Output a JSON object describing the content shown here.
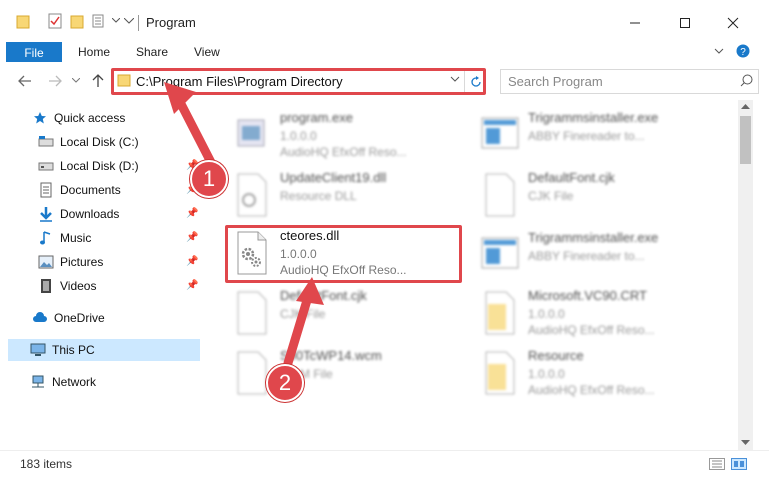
{
  "window": {
    "title": "Program"
  },
  "ribbon": {
    "file": "File",
    "home": "Home",
    "share": "Share",
    "view": "View"
  },
  "address": {
    "path": "C:\\Program Files\\Program Directory"
  },
  "search": {
    "placeholder": "Search Program"
  },
  "sidebar": {
    "quick_access": "Quick access",
    "items": [
      {
        "label": "Local Disk (C:)"
      },
      {
        "label": "Local Disk (D:)"
      },
      {
        "label": "Documents"
      },
      {
        "label": "Downloads"
      },
      {
        "label": "Music"
      },
      {
        "label": "Pictures"
      },
      {
        "label": "Videos"
      }
    ],
    "onedrive": "OneDrive",
    "this_pc": "This PC",
    "network": "Network"
  },
  "files": {
    "f1": {
      "name": "program.exe",
      "l2": "1.0.0.0",
      "l3": "AudioHQ EfxOff Reso..."
    },
    "f2": {
      "name": "Trigrammsinstaller.exe",
      "l2": "ABBY Finereader to..."
    },
    "f3": {
      "name": "UpdateClient19.dll",
      "l2": "Resource DLL"
    },
    "f4": {
      "name": "DefaultFont.cjk",
      "l2": "CJK File"
    },
    "f5": {
      "name": "cteores.dll",
      "l2": "1.0.0.0",
      "l3": "AudioHQ EfxOff Reso..."
    },
    "f6": {
      "name": "Trigrammsinstaller.exe",
      "l2": "ABBY Finereader to..."
    },
    "f7": {
      "name": "DefaultFont.cjk",
      "l2": "CJK File"
    },
    "f8": {
      "name": "Microsoft.VC90.CRT",
      "l2": "1.0.0.0",
      "l3": "AudioHQ EfxOff Reso..."
    },
    "f9": {
      "name": "S00TcWP14.wcm",
      "l2": "WCM File"
    },
    "f10": {
      "name": "Resource",
      "l2": "1.0.0.0",
      "l3": "AudioHQ EfxOff Reso..."
    }
  },
  "status": {
    "items": "183 items"
  },
  "badges": {
    "one": "1",
    "two": "2"
  },
  "colors": {
    "accent": "#1979ca",
    "highlight": "#e0474c",
    "selected": "#cce8ff"
  }
}
